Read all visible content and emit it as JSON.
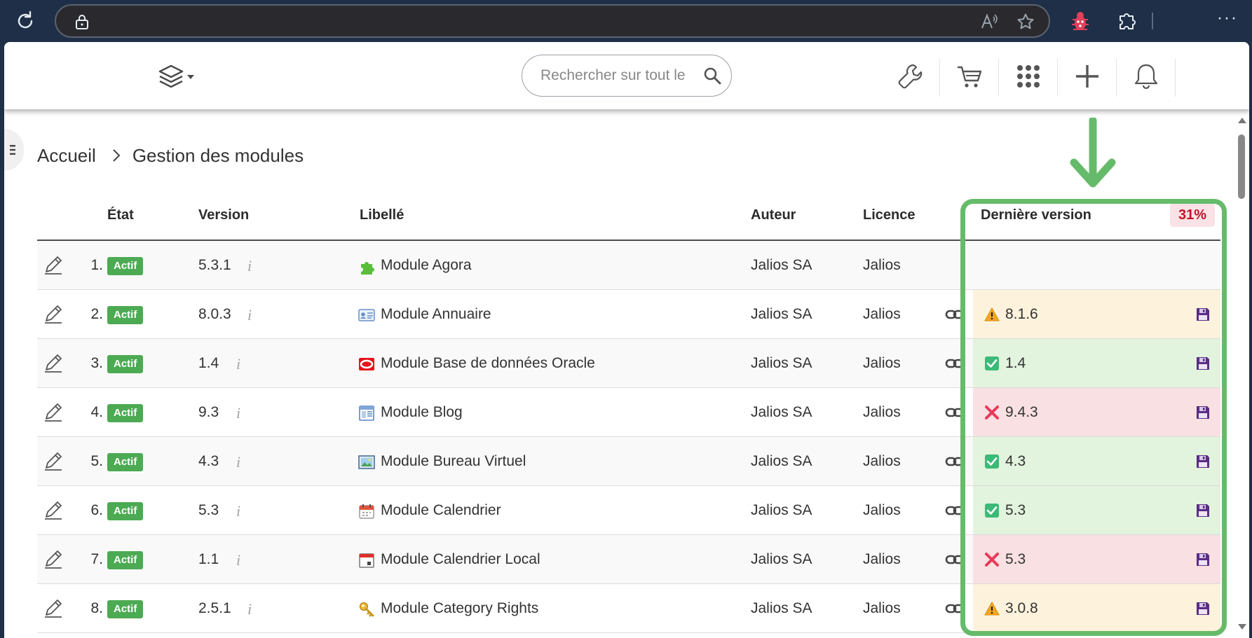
{
  "browser": {
    "address_value": "",
    "icons": [
      "reload-icon",
      "lock-icon",
      "read-aloud-icon",
      "favorite-star-icon",
      "extension-bug-icon",
      "extensions-puzzle-icon",
      "more-menu-icon"
    ],
    "more_label": "···"
  },
  "nav": {
    "search_placeholder": "Rechercher sur tout le site",
    "icons": [
      "layers-icon",
      "wrench-icon",
      "cart-icon",
      "apps-grid-icon",
      "plus-icon",
      "bell-icon"
    ]
  },
  "breadcrumb": {
    "home": "Accueil",
    "current": "Gestion des modules"
  },
  "table": {
    "headers": {
      "state": "État",
      "version": "Version",
      "label": "Libellé",
      "author": "Auteur",
      "licence": "Licence",
      "latest": "Dernière version"
    },
    "latest_percent": "31%",
    "rows": [
      {
        "num": "1.",
        "state": "Actif",
        "version": "5.3.1",
        "info": "i",
        "icon": "puzzle-icon",
        "label": "Module Agora",
        "author": "Jalios SA",
        "licence": "Jalios",
        "latest": "",
        "status": "none"
      },
      {
        "num": "2.",
        "state": "Actif",
        "version": "8.0.3",
        "info": "i",
        "icon": "contact-card-icon",
        "label": "Module Annuaire",
        "author": "Jalios SA",
        "licence": "Jalios",
        "latest": "8.1.6",
        "status": "warn"
      },
      {
        "num": "3.",
        "state": "Actif",
        "version": "1.4",
        "info": "i",
        "icon": "oracle-icon",
        "label": "Module Base de données Oracle",
        "author": "Jalios SA",
        "licence": "Jalios",
        "latest": "1.4",
        "status": "ok"
      },
      {
        "num": "4.",
        "state": "Actif",
        "version": "9.3",
        "info": "i",
        "icon": "blog-page-icon",
        "label": "Module Blog",
        "author": "Jalios SA",
        "licence": "Jalios",
        "latest": "9.4.3",
        "status": "bad"
      },
      {
        "num": "5.",
        "state": "Actif",
        "version": "4.3",
        "info": "i",
        "icon": "desktop-picture-icon",
        "label": "Module Bureau Virtuel",
        "author": "Jalios SA",
        "licence": "Jalios",
        "latest": "4.3",
        "status": "ok"
      },
      {
        "num": "6.",
        "state": "Actif",
        "version": "5.3",
        "info": "i",
        "icon": "calendar-icon",
        "label": "Module Calendrier",
        "author": "Jalios SA",
        "licence": "Jalios",
        "latest": "5.3",
        "status": "ok"
      },
      {
        "num": "7.",
        "state": "Actif",
        "version": "1.1",
        "info": "i",
        "icon": "calendar-local-icon",
        "label": "Module Calendrier Local",
        "author": "Jalios SA",
        "licence": "Jalios",
        "latest": "5.3",
        "status": "bad"
      },
      {
        "num": "8.",
        "state": "Actif",
        "version": "2.5.1",
        "info": "i",
        "icon": "key-icon",
        "label": "Module Category Rights",
        "author": "Jalios SA",
        "licence": "Jalios",
        "latest": "3.0.8",
        "status": "warn"
      }
    ]
  },
  "colors": {
    "browser_chrome": "#1e2f47",
    "active_badge": "#4caa53",
    "annotation_green": "#66bb6a",
    "warn_bg": "#fdf2dc",
    "ok_bg": "#e2f3de",
    "bad_bg": "#f9e0e2",
    "percent_badge_text": "#c0142a"
  }
}
